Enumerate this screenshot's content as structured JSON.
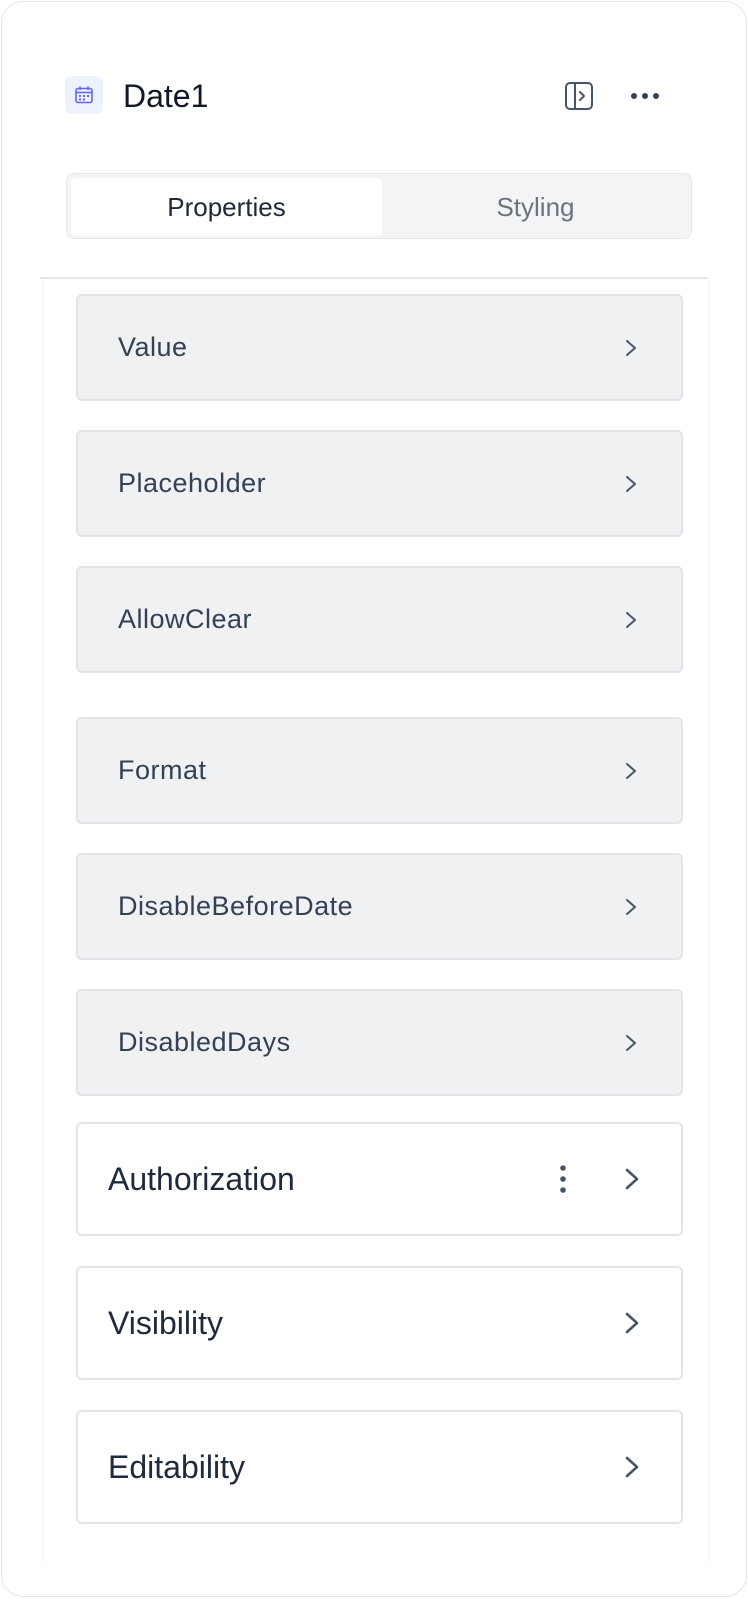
{
  "header": {
    "title": "Date1",
    "component_icon": "calendar-icon",
    "panel_toggle_icon": "panel-toggle-icon",
    "more_icon": "more-horizontal-icon"
  },
  "tabs": [
    {
      "label": "Properties",
      "active": true
    },
    {
      "label": "Styling",
      "active": false
    }
  ],
  "properties": [
    {
      "label": "Value"
    },
    {
      "label": "Placeholder"
    },
    {
      "label": "AllowClear"
    },
    {
      "label": "Format"
    },
    {
      "label": "DisableBeforeDate"
    },
    {
      "label": "DisabledDays"
    }
  ],
  "sections": [
    {
      "label": "Authorization",
      "has_menu": true
    },
    {
      "label": "Visibility",
      "has_menu": false
    },
    {
      "label": "Editability",
      "has_menu": false
    }
  ],
  "colors": {
    "accent": "#6366f1",
    "text_primary": "#1e293b",
    "text_muted": "#6b7280",
    "row_background": "#f0f1f3",
    "border": "#e2e4e8"
  }
}
